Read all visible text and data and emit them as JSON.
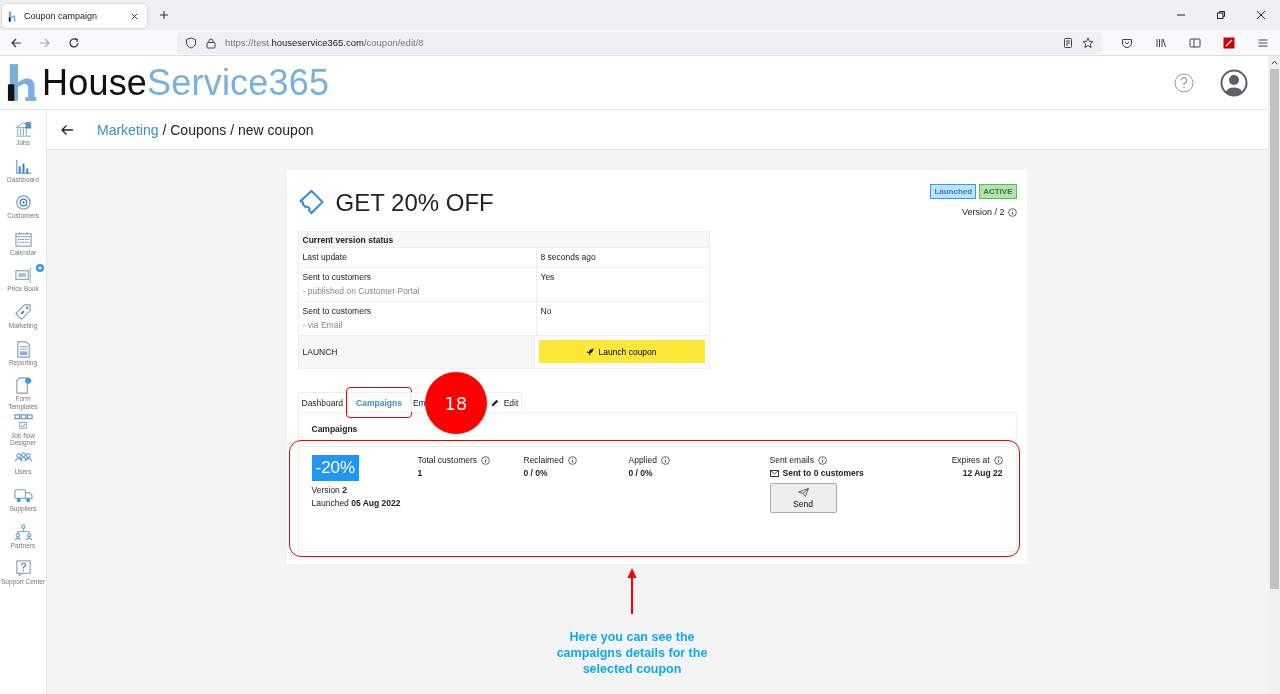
{
  "browser": {
    "tab_title": "Coupon campaign",
    "url": "https://test.**houseservice365.com**/coupon/edit/8"
  },
  "app_header": {
    "logo_part_1": "House",
    "logo_part_2": "Service365"
  },
  "sidebar": {
    "items": [
      {
        "label": "Jobs"
      },
      {
        "label": "Dashboard"
      },
      {
        "label": "Customers"
      },
      {
        "label": "Calendar"
      },
      {
        "label": "Price Book"
      },
      {
        "label": "Marketing"
      },
      {
        "label": "Reporting"
      },
      {
        "label": "Form Templates"
      },
      {
        "label": "Job flow Designer"
      },
      {
        "label": "Users"
      },
      {
        "label": "Suppliers"
      },
      {
        "label": "Partners"
      },
      {
        "label": "Support Center"
      }
    ]
  },
  "breadcrumb": {
    "link": "Marketing",
    "rest": "/ Coupons / new coupon"
  },
  "coupon": {
    "title": "GET 20% OFF",
    "badges": [
      {
        "label": "Launched",
        "kind": "info"
      },
      {
        "label": "ACTIVE",
        "kind": "success"
      }
    ],
    "version": "Version / 2",
    "status_table": {
      "heading": "Current version status",
      "rows": [
        {
          "kind": "text",
          "label": "Last update",
          "value": "8 seconds ago"
        },
        {
          "kind": "text",
          "label": "Sent to customers",
          "sublabel": "- published on Customer Portal",
          "value": "Yes"
        },
        {
          "kind": "text",
          "label": "Sent to customers",
          "sublabel": "- via Email",
          "value": "No"
        },
        {
          "kind": "button",
          "label": "LAUNCH",
          "value": "Launch coupon"
        }
      ]
    },
    "tabs": [
      {
        "label": "Dashboard",
        "selected": false
      },
      {
        "label": "Campaigns",
        "selected": true
      },
      {
        "label": "Em",
        "selected": false
      },
      {
        "label": "Edit",
        "selected": false
      }
    ],
    "campaigns": {
      "title": "Campaigns",
      "discount": "-20%",
      "version": "Version **2**",
      "launched": "Launched **05 Aug 2022**",
      "stats": [
        {
          "label": "Total customers",
          "value": "1"
        },
        {
          "label": "Reclaimed",
          "value": "0 / 0%"
        },
        {
          "label": "Applied",
          "value": "0 / 0%"
        }
      ],
      "sent_emails": {
        "label": "Sent emails",
        "value": "Sent to 0 customers",
        "button": "Send"
      },
      "expires": {
        "label": "Expires at",
        "value": "12 Aug 22"
      }
    }
  },
  "annotation": {
    "step": "18",
    "note": "Here you can see the campaigns  details for the selected coupon"
  }
}
